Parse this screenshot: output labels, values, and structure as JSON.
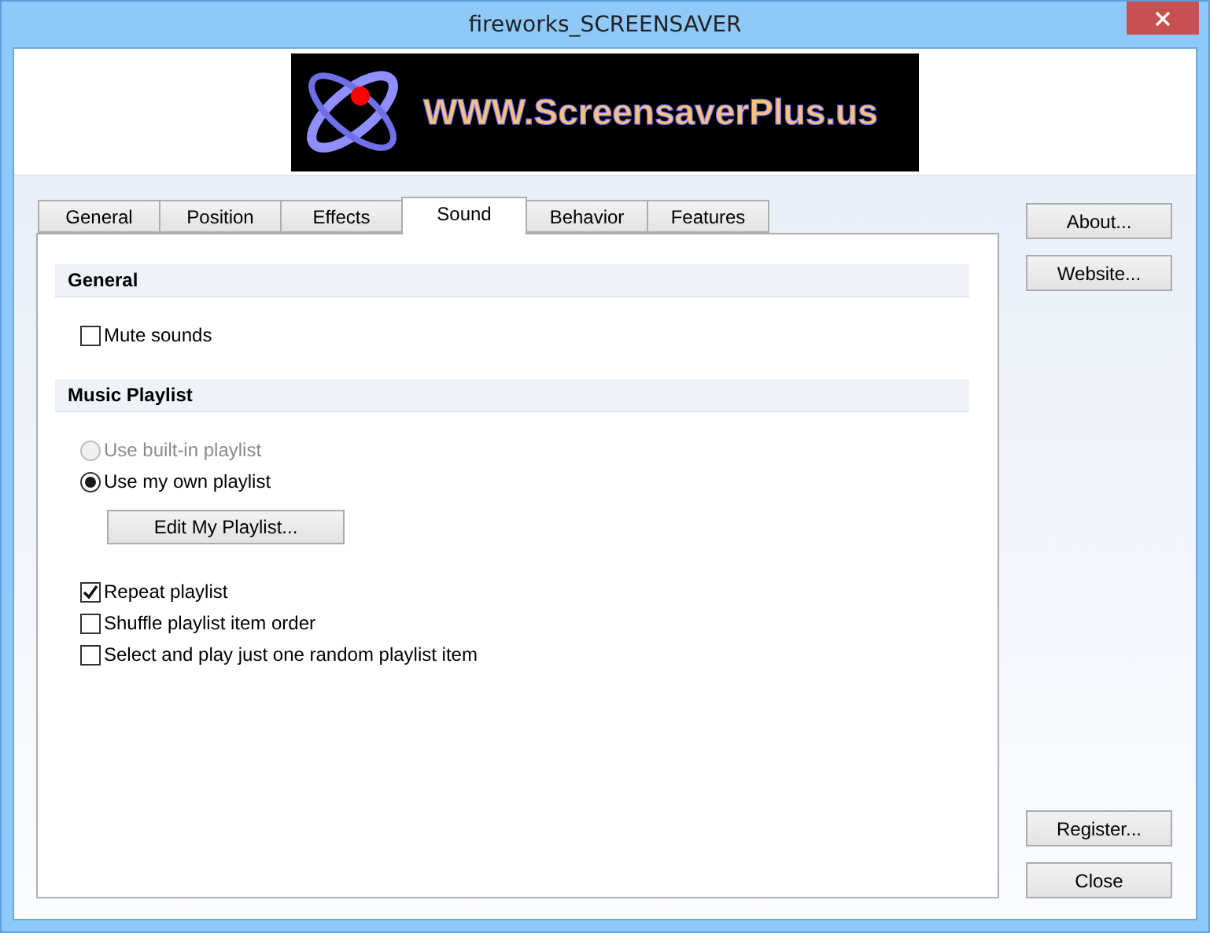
{
  "window": {
    "title": "fireworks_SCREENSAVER"
  },
  "banner": {
    "text": "WWW.ScreensaverPlus.us"
  },
  "tabs": [
    {
      "label": "General",
      "selected": false
    },
    {
      "label": "Position",
      "selected": false
    },
    {
      "label": "Effects",
      "selected": false
    },
    {
      "label": "Sound",
      "selected": true
    },
    {
      "label": "Behavior",
      "selected": false
    },
    {
      "label": "Features",
      "selected": false
    }
  ],
  "sections": [
    {
      "title": "General",
      "options": [
        {
          "kind": "checkbox",
          "label": "Mute sounds",
          "checked": false,
          "disabled": false
        }
      ]
    },
    {
      "title": "Music Playlist",
      "options": [
        {
          "kind": "radio",
          "label": "Use built-in playlist",
          "selected": false,
          "disabled": true
        },
        {
          "kind": "radio",
          "label": "Use my own playlist",
          "selected": true,
          "disabled": false
        },
        {
          "kind": "button",
          "label": "Edit My Playlist..."
        },
        {
          "kind": "checkbox",
          "label": "Repeat playlist",
          "checked": true,
          "disabled": false
        },
        {
          "kind": "checkbox",
          "label": "Shuffle playlist item order",
          "checked": false,
          "disabled": false
        },
        {
          "kind": "checkbox",
          "label": "Select and play just one random playlist item",
          "checked": false,
          "disabled": false
        }
      ]
    }
  ],
  "side_buttons_top": [
    "About...",
    "Website..."
  ],
  "side_buttons_bottom": [
    "Register...",
    "Close"
  ]
}
